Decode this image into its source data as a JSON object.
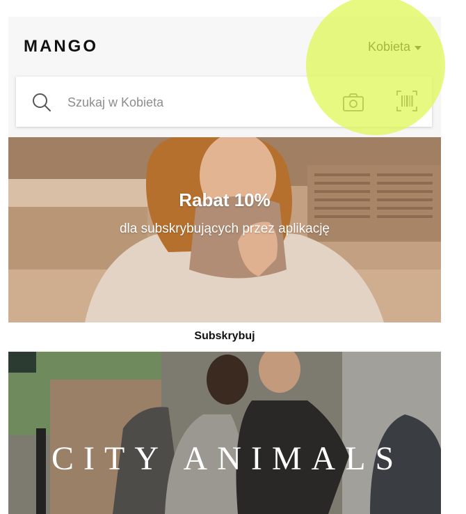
{
  "header": {
    "logo": "MANGO",
    "section": "Kobieta"
  },
  "search": {
    "placeholder": "Szukaj w Kobieta"
  },
  "icons": {
    "search": "search-icon",
    "camera": "camera-icon",
    "barcode": "barcode-scan-icon",
    "dropdown": "caret-down-icon"
  },
  "promo": {
    "title": "Rabat 10%",
    "subtitle": "dla subskrybujących przez aplikację",
    "cta": "Subskrybuj"
  },
  "campaign": {
    "title": "CITY ANIMALS"
  },
  "colors": {
    "highlight": "#def650",
    "text": "#111111"
  }
}
